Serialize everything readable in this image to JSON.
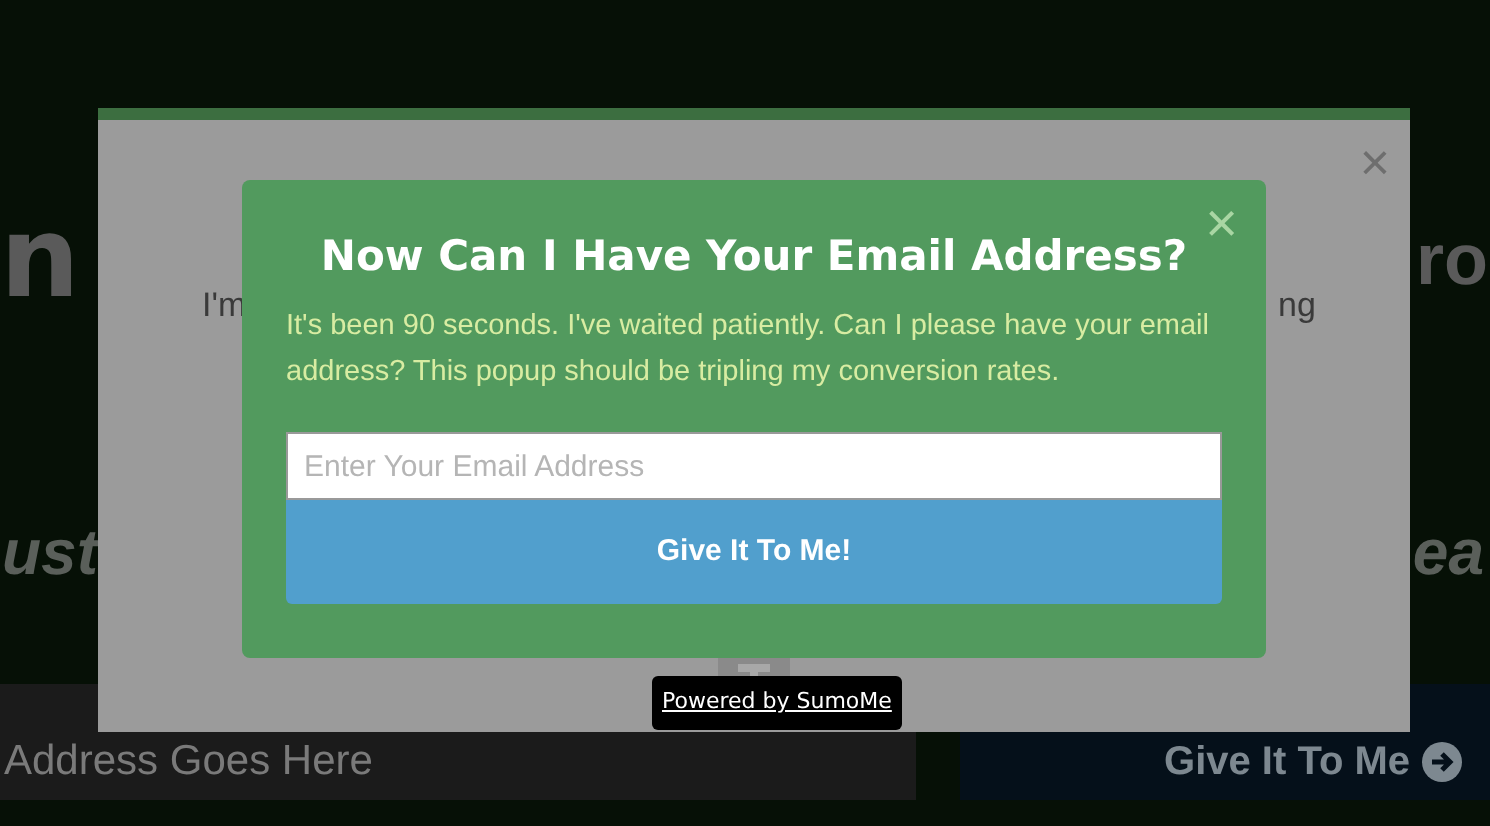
{
  "background_page": {
    "heading_left": "n",
    "heading_right": "ro",
    "subheading_left": "ust",
    "subheading_right": "ea",
    "email_field": {
      "placeholder": "Address Goes Here"
    },
    "submit_button": {
      "label": "Give It To Me"
    }
  },
  "modal": {
    "close": "×",
    "text_left": "I'm",
    "text_right": "ng",
    "badge": "Powered by SumoMe"
  },
  "popup": {
    "close": "×",
    "title": "Now Can I Have Your Email Address?",
    "message": "It's been 90 seconds. I've waited patiently. Can I please have your email address? This popup should be tripling my conversion rates.",
    "email_field": {
      "placeholder": "Enter Your Email Address"
    },
    "submit_button": {
      "label": "Give It To Me!"
    }
  }
}
